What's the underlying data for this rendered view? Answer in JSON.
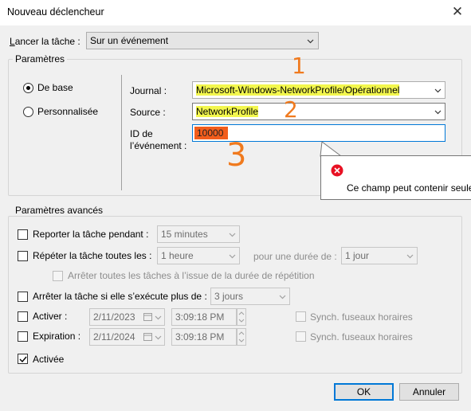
{
  "window": {
    "title": "Nouveau déclencheur",
    "close_glyph": "✕"
  },
  "launch": {
    "label_prefix": "L",
    "label_rest": "ancer la tâche :",
    "value": "Sur un événement"
  },
  "params": {
    "title": "Paramètres",
    "radio_base": "De base",
    "radio_custom": "Personnalisée",
    "journal_label": "Journal :",
    "journal_value": "Microsoft-Windows-NetworkProfile/Opérationnel",
    "source_label": "Source :",
    "source_value": "NetworkProfile",
    "eventid_label_1": "ID de",
    "eventid_label_2": "l’événement :",
    "eventid_value": "10000"
  },
  "annotations": {
    "one": "1",
    "two": "2",
    "three": "3"
  },
  "tooltip": {
    "text": "Ce champ peut contenir seule"
  },
  "advanced": {
    "title": "Paramètres avancés",
    "delay_label": "Reporter la tâche pendant :",
    "delay_value": "15 minutes",
    "repeat_label": "Répéter la tâche toutes les :",
    "repeat_value": "1 heure",
    "duration_label": "pour une durée de :",
    "duration_value": "1 jour",
    "stop_all_label": "Arrêter toutes les tâches à l’issue de la durée de répétition",
    "stop_if_label": "Arrêter la tâche si elle s’exécute plus de :",
    "stop_if_value": "3 jours",
    "activate_label": "Activer :",
    "activate_date": "2/11/2023",
    "activate_time": "3:09:18 PM",
    "expire_label": "Expiration :",
    "expire_date": "2/11/2024",
    "expire_time": "3:09:18 PM",
    "sync_tz_1": "Synch. fuseaux horaires",
    "sync_tz_2": "Synch. fuseaux horaires",
    "enabled_label": "Activée"
  },
  "buttons": {
    "ok": "OK",
    "cancel": "Annuler"
  },
  "colors": {
    "highlight": "#f3f74d",
    "annotation": "#f07a1e",
    "error": "#e81123"
  }
}
